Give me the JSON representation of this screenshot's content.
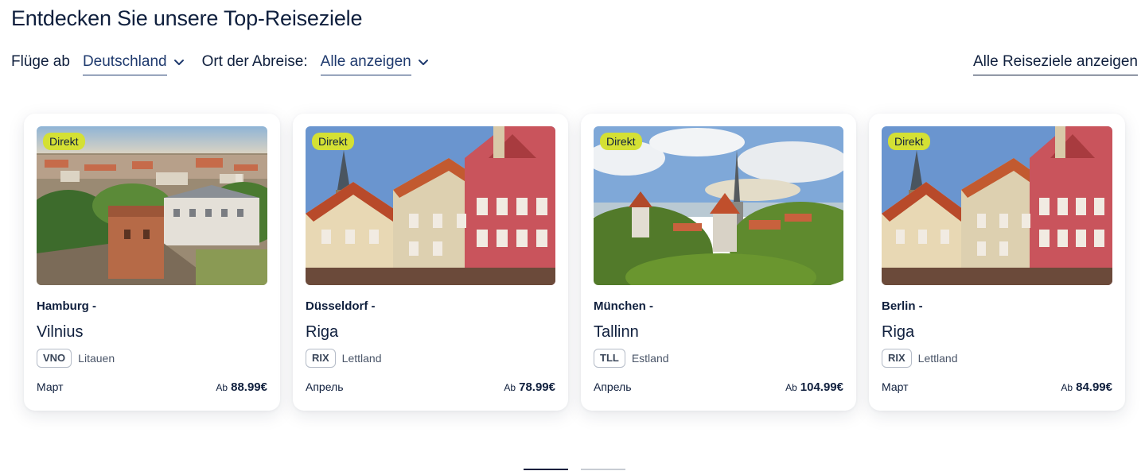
{
  "title": "Entdecken Sie unsere Top-Reiseziele",
  "filters": {
    "flights_label": "Flüge ab",
    "flights_value": "Deutschland",
    "departure_label": "Ort der Abreise:",
    "departure_value": "Alle anzeigen"
  },
  "all_destinations_link": "Alle Reiseziele anzeigen",
  "cards": [
    {
      "badge": "Direkt",
      "from": "Hamburg -",
      "to": "Vilnius",
      "code": "VNO",
      "country": "Litauen",
      "month": "Март",
      "price_prefix": "Ab",
      "price": "88.99€",
      "image": "vilnius-castle-photo"
    },
    {
      "badge": "Direkt",
      "from": "Düsseldorf -",
      "to": "Riga",
      "code": "RIX",
      "country": "Lettland",
      "month": "Апрель",
      "price_prefix": "Ab",
      "price": "78.99€",
      "image": "riga-old-town-photo"
    },
    {
      "badge": "Direkt",
      "from": "München -",
      "to": "Tallinn",
      "code": "TLL",
      "country": "Estland",
      "month": "Апрель",
      "price_prefix": "Ab",
      "price": "104.99€",
      "image": "tallinn-towers-photo"
    },
    {
      "badge": "Direkt",
      "from": "Berlin -",
      "to": "Riga",
      "code": "RIX",
      "country": "Lettland",
      "month": "Март",
      "price_prefix": "Ab",
      "price": "84.99€",
      "image": "riga-old-town-photo"
    }
  ],
  "pagination": {
    "pages": 2,
    "current": 1
  },
  "colors": {
    "text": "#0f1f3d",
    "link": "#1f3a6e",
    "badge": "#d4e034"
  }
}
